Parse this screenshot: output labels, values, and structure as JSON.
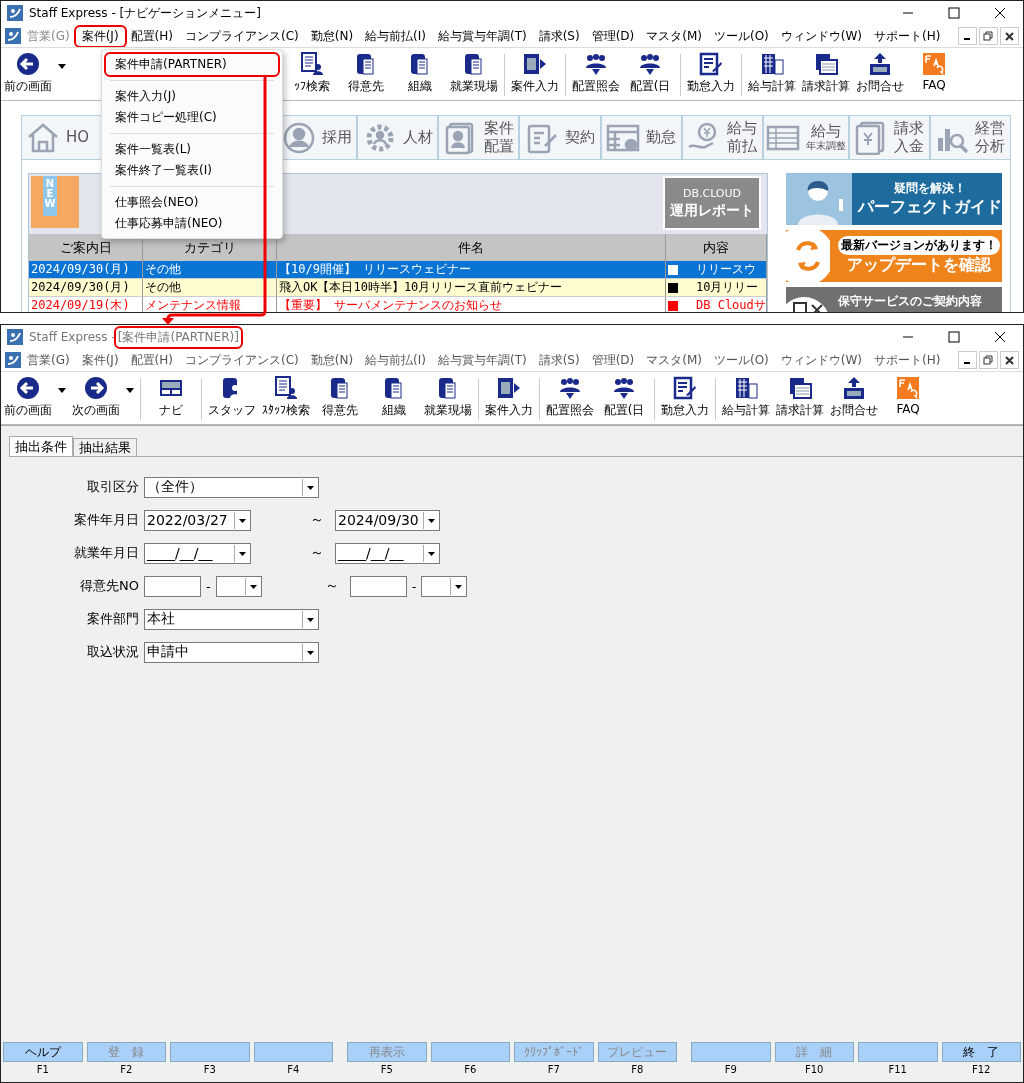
{
  "top_window": {
    "title": "Staff Express - [ナビゲーションメニュー]",
    "active": true,
    "menu": [
      {
        "label": "営業(G)",
        "disabled": true,
        "annotated": false
      },
      {
        "label": "案件(J)",
        "disabled": false,
        "annotated": true
      },
      {
        "label": "配置(H)",
        "disabled": false,
        "annotated": false
      },
      {
        "label": "コンプライアンス(C)",
        "disabled": false,
        "annotated": false
      },
      {
        "label": "勤怠(N)",
        "disabled": false,
        "annotated": false
      },
      {
        "label": "給与前払(I)",
        "disabled": false,
        "annotated": false
      },
      {
        "label": "給与賞与年調(T)",
        "disabled": false,
        "annotated": false
      },
      {
        "label": "請求(S)",
        "disabled": false,
        "annotated": false
      },
      {
        "label": "管理(D)",
        "disabled": false,
        "annotated": false
      },
      {
        "label": "マスタ(M)",
        "disabled": false,
        "annotated": false
      },
      {
        "label": "ツール(O)",
        "disabled": false,
        "annotated": false
      },
      {
        "label": "ウィンドウ(W)",
        "disabled": false,
        "annotated": false
      },
      {
        "label": "サポート(H)",
        "disabled": false,
        "annotated": false
      }
    ],
    "toolbar_lead": {
      "kind": "back",
      "label": "前の画面"
    },
    "toolbar": [
      {
        "kind": "docperson",
        "label": "ｯﾌ検索",
        "sep": false
      },
      {
        "kind": "building",
        "label": "得意先",
        "sep": false
      },
      {
        "kind": "building",
        "label": "組織",
        "sep": false
      },
      {
        "kind": "building",
        "label": "就業現場",
        "sep": true
      },
      {
        "kind": "docarrow",
        "label": "案件入力",
        "sep": true
      },
      {
        "kind": "people",
        "label": "配置照会",
        "sep": false
      },
      {
        "kind": "people",
        "label": "配置(日",
        "sep": true
      },
      {
        "kind": "edit",
        "label": "勤怠入力",
        "sep": true
      },
      {
        "kind": "calc",
        "label": "給与計算",
        "sep": false
      },
      {
        "kind": "invoice",
        "label": "請求計算",
        "sep": false
      },
      {
        "kind": "upload",
        "label": "お問合せ",
        "sep": false
      },
      {
        "kind": "faq",
        "label": "FAQ",
        "sep": false
      }
    ],
    "nav_tabs": [
      {
        "kind": "home",
        "lines": [
          "HO"
        ]
      },
      {
        "kind": "person",
        "lines": [
          "採用"
        ]
      },
      {
        "kind": "gear",
        "lines": [
          "人材"
        ]
      },
      {
        "kind": "card",
        "lines": [
          "案件",
          "配置"
        ]
      },
      {
        "kind": "contract",
        "lines": [
          "契約"
        ]
      },
      {
        "kind": "attend",
        "lines": [
          "勤怠"
        ]
      },
      {
        "kind": "yen",
        "lines": [
          "給与",
          "前払"
        ]
      },
      {
        "kind": "sheet",
        "lines": [
          "給与",
          "年末調整"
        ]
      },
      {
        "kind": "bill",
        "lines": [
          "請求",
          "入金"
        ]
      },
      {
        "kind": "chart",
        "lines": [
          "経営",
          "分析"
        ]
      }
    ],
    "news": {
      "ribbon": "NEW",
      "report_button": {
        "logo": "DB.CLOUD",
        "label": "運用レポート"
      },
      "columns": [
        "ご案内日",
        "カテゴリ",
        "件名",
        "内容"
      ],
      "rows": [
        {
          "kind": "normal",
          "selected": true,
          "date": "2024/09/30(月)",
          "category": "その他",
          "subject": "【10/9開催】 リリースウェビナー",
          "color": "#ffffff",
          "content": "リリースウ"
        },
        {
          "kind": "pinned",
          "selected": false,
          "date": "2024/09/30(月)",
          "category": "その他",
          "subject": "飛入OK【本日10時半】10月リリース直前ウェビナー",
          "color": "#000000",
          "content": "10月リリー"
        },
        {
          "kind": "alert",
          "selected": false,
          "date": "2024/09/19(木)",
          "category": "メンテナンス情報",
          "subject": "【重要】 サーバメンテナンスのお知らせ",
          "color": "#ff0000",
          "content": "DB Cloudサ"
        }
      ]
    },
    "banners": [
      {
        "kind": "guide",
        "lines": [
          "疑問を解決！",
          "パーフェクトガイド"
        ]
      },
      {
        "kind": "update",
        "lines": [
          "最新バージョンがあります！",
          "アップデートを確認"
        ]
      },
      {
        "kind": "maintenance",
        "lines": [
          "保守サービスのご契約内容"
        ]
      }
    ],
    "dropdown": [
      {
        "kind": "item",
        "label": "案件申請(PARTNER)",
        "annotated": true
      },
      {
        "kind": "separator"
      },
      {
        "kind": "item",
        "label": "案件入力(J)",
        "annotated": false
      },
      {
        "kind": "item",
        "label": "案件コピー処理(C)",
        "annotated": false
      },
      {
        "kind": "separator"
      },
      {
        "kind": "item",
        "label": "案件一覧表(L)",
        "annotated": false
      },
      {
        "kind": "item",
        "label": "案件終了一覧表(I)",
        "annotated": false
      },
      {
        "kind": "separator"
      },
      {
        "kind": "item",
        "label": "仕事照会(NEO)",
        "annotated": false
      },
      {
        "kind": "item",
        "label": "仕事応募申請(NEO)",
        "annotated": false
      }
    ]
  },
  "bottom_window": {
    "title": "Staff Express - ",
    "document": "[案件申請(PARTNER)]",
    "document_annotated": true,
    "active": false,
    "menu": [
      "営業(G)",
      "案件(J)",
      "配置(H)",
      "コンプライアンス(C)",
      "勤怠(N)",
      "給与前払(I)",
      "給与賞与年調(T)",
      "請求(S)",
      "管理(D)",
      "マスタ(M)",
      "ツール(O)",
      "ウィンドウ(W)",
      "サポート(H)"
    ],
    "toolbar": [
      {
        "kind": "back",
        "label": "前の画面",
        "caret": true,
        "sep": false
      },
      {
        "kind": "forward",
        "label": "次の画面",
        "caret": true,
        "sep": true
      },
      {
        "kind": "navi",
        "label": "ナビ",
        "caret": false,
        "sep": true
      },
      {
        "kind": "person",
        "label": "スタッフ",
        "caret": false,
        "sep": false
      },
      {
        "kind": "docperson",
        "label": "ｽﾀｯﾌ検索",
        "caret": false,
        "sep": false
      },
      {
        "kind": "building",
        "label": "得意先",
        "caret": false,
        "sep": false
      },
      {
        "kind": "building",
        "label": "組織",
        "caret": false,
        "sep": false
      },
      {
        "kind": "building",
        "label": "就業現場",
        "caret": false,
        "sep": true
      },
      {
        "kind": "docarrow",
        "label": "案件入力",
        "caret": false,
        "sep": true
      },
      {
        "kind": "people",
        "label": "配置照会",
        "caret": false,
        "sep": false
      },
      {
        "kind": "people",
        "label": "配置(日",
        "caret": false,
        "sep": true
      },
      {
        "kind": "edit",
        "label": "勤怠入力",
        "caret": false,
        "sep": true
      },
      {
        "kind": "calc",
        "label": "給与計算",
        "caret": false,
        "sep": false
      },
      {
        "kind": "invoice",
        "label": "請求計算",
        "caret": false,
        "sep": false
      },
      {
        "kind": "upload",
        "label": "お問合せ",
        "caret": false,
        "sep": false
      },
      {
        "kind": "faq",
        "label": "FAQ",
        "caret": false,
        "sep": false
      }
    ],
    "tabs": [
      {
        "label": "抽出条件",
        "selected": true
      },
      {
        "label": "抽出結果",
        "selected": false
      }
    ],
    "form": [
      {
        "kind": "select",
        "label": "取引区分",
        "value": "（全件）"
      },
      {
        "kind": "date_range",
        "label": "案件年月日",
        "from": "2022/03/27",
        "separator": "～",
        "to": "2024/09/30"
      },
      {
        "kind": "date_range",
        "label": "就業年月日",
        "from": "____/__/__",
        "separator": "～",
        "to": "____/__/__"
      },
      {
        "kind": "code_range",
        "label": "得意先NO",
        "dash": "-",
        "separator": "～"
      },
      {
        "kind": "select",
        "label": "案件部門",
        "value": "本社"
      },
      {
        "kind": "select",
        "label": "取込状況",
        "value": "申請中"
      }
    ],
    "function_keys": [
      {
        "label": "ヘルプ",
        "key": "F1",
        "disabled": false
      },
      {
        "label": "登　録",
        "key": "F2",
        "disabled": true
      },
      {
        "key": "F3"
      },
      {
        "key": "F4"
      },
      {
        "label": "再表示",
        "key": "F5",
        "disabled": true
      },
      {
        "key": "F6"
      },
      {
        "label": "ｸﾘｯﾌﾟﾎﾞｰﾄﾞ",
        "key": "F7",
        "disabled": true
      },
      {
        "label": "プレビュー",
        "key": "F8",
        "disabled": true
      },
      {
        "key": "F9"
      },
      {
        "label": "詳　細",
        "key": "F10",
        "disabled": true
      },
      {
        "key": "F11"
      },
      {
        "label": "終　了",
        "key": "F12",
        "disabled": false
      }
    ]
  }
}
